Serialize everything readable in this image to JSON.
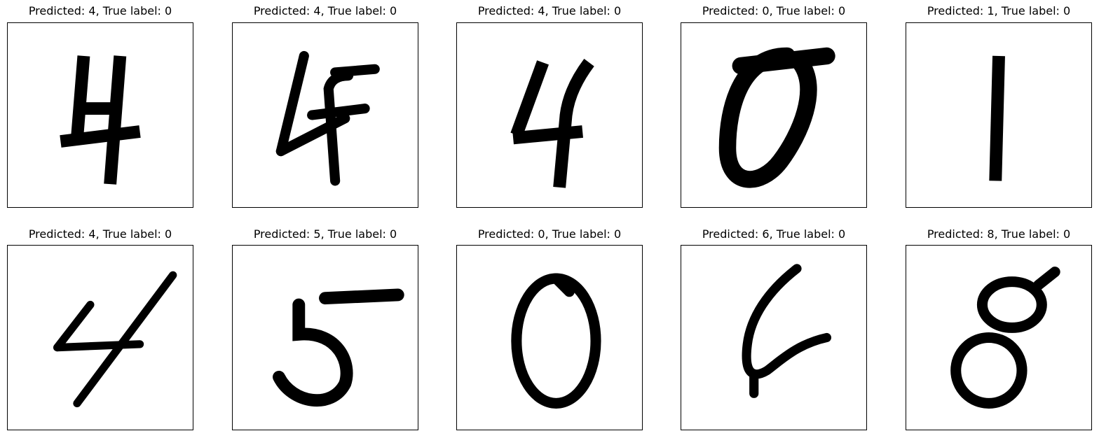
{
  "panels": [
    {
      "title": "Predicted: 4, True label: 0",
      "predicted": 4,
      "true_label": 0,
      "digit_image": "handwritten-digit-4"
    },
    {
      "title": "Predicted: 4, True label: 0",
      "predicted": 4,
      "true_label": 0,
      "digit_image": "handwritten-digit-4"
    },
    {
      "title": "Predicted: 4, True label: 0",
      "predicted": 4,
      "true_label": 0,
      "digit_image": "handwritten-digit-4"
    },
    {
      "title": "Predicted: 0, True label: 0",
      "predicted": 0,
      "true_label": 0,
      "digit_image": "handwritten-digit-0"
    },
    {
      "title": "Predicted: 1, True label: 0",
      "predicted": 1,
      "true_label": 0,
      "digit_image": "handwritten-digit-1"
    },
    {
      "title": "Predicted: 4, True label: 0",
      "predicted": 4,
      "true_label": 0,
      "digit_image": "handwritten-digit-4"
    },
    {
      "title": "Predicted: 5, True label: 0",
      "predicted": 5,
      "true_label": 0,
      "digit_image": "handwritten-digit-5"
    },
    {
      "title": "Predicted: 0, True label: 0",
      "predicted": 0,
      "true_label": 0,
      "digit_image": "handwritten-digit-0"
    },
    {
      "title": "Predicted: 6, True label: 0",
      "predicted": 6,
      "true_label": 0,
      "digit_image": "handwritten-digit-6"
    },
    {
      "title": "Predicted: 8, True label: 0",
      "predicted": 8,
      "true_label": 0,
      "digit_image": "handwritten-digit-8"
    }
  ],
  "colors": {
    "ink": "#000000",
    "frame": "#000000",
    "background": "#ffffff"
  }
}
